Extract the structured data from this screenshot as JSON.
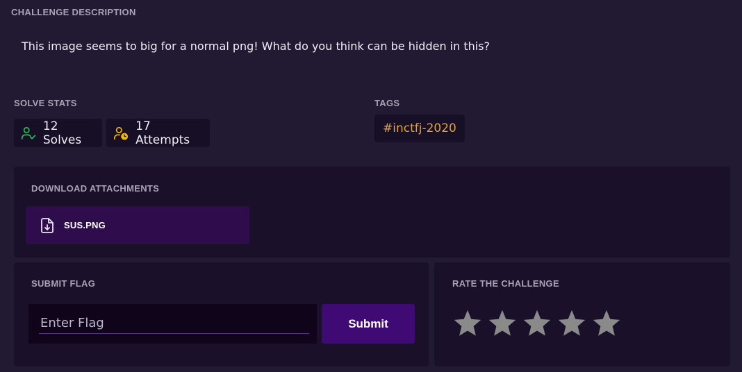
{
  "description": {
    "heading": "CHALLENGE DESCRIPTION",
    "text": "This image seems to big for a normal png! What do you think can be hidden in this?"
  },
  "solve_stats": {
    "heading": "SOLVE STATS",
    "solves": "12 Solves",
    "attempts": "17 Attempts",
    "solves_icon": "user-check-icon",
    "attempts_icon": "user-clock-icon"
  },
  "tags": {
    "heading": "TAGS",
    "items": [
      "#inctfj-2020"
    ]
  },
  "attachments": {
    "heading": "DOWNLOAD ATTACHMENTS",
    "files": [
      {
        "name": "SUS.PNG",
        "icon": "file-download-icon"
      }
    ]
  },
  "submit_flag": {
    "heading": "SUBMIT FLAG",
    "placeholder": "Enter Flag",
    "value": "",
    "button_label": "Submit"
  },
  "rating": {
    "heading": "RATE THE CHALLENGE",
    "max_stars": 5,
    "current_rating": 0
  },
  "colors": {
    "background": "#221a33",
    "panel": "#1a1029",
    "accent": "#3f0a73",
    "solves_green": "#27c25f",
    "attempts_yellow": "#f2b705",
    "tag_orange": "#e0a040",
    "star_gray": "#8a8a8a"
  }
}
